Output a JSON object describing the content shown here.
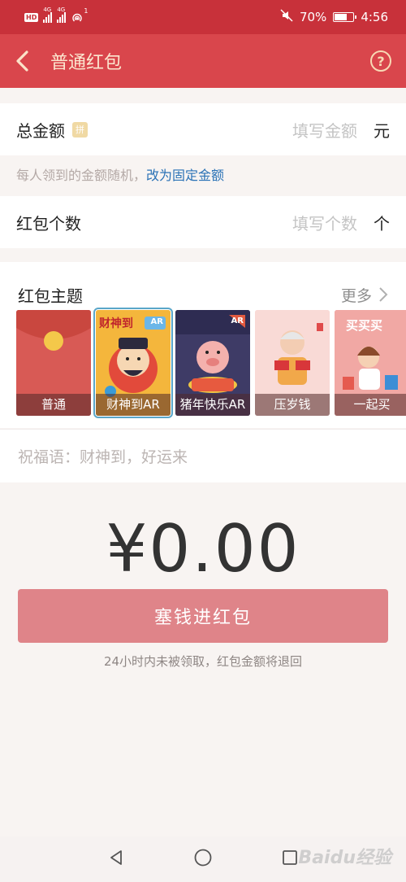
{
  "status_bar": {
    "hd": "HD",
    "net1": "4G",
    "net2": "4G",
    "hotspot_count": "1",
    "battery_percent": "70%",
    "battery_level": 0.7,
    "time": "4:56"
  },
  "header": {
    "title": "普通红包",
    "help_symbol": "?"
  },
  "total_amount": {
    "label": "总金额",
    "badge": "拼",
    "placeholder": "填写金额",
    "unit": "元"
  },
  "hint": {
    "text": "每人领到的金额随机，",
    "link": "改为固定金额"
  },
  "count": {
    "label": "红包个数",
    "placeholder": "填写个数",
    "unit": "个"
  },
  "theme": {
    "title": "红包主题",
    "more": "更多",
    "cards": [
      {
        "label": "普通",
        "selected": false
      },
      {
        "label": "财神到AR",
        "selected": true
      },
      {
        "label": "猪年快乐AR",
        "selected": false
      },
      {
        "label": "压岁钱",
        "selected": false
      },
      {
        "label": "一起买",
        "selected": false
      }
    ],
    "card_texts": {
      "caishen": "财神到",
      "ar": "AR",
      "maimai": "买买买"
    }
  },
  "blessing": {
    "placeholder": "祝福语：财神到，好运来"
  },
  "amount_display": "¥0.00",
  "submit_label": "塞钱进红包",
  "footer_note": "24小时内未被领取，红包金额将退回",
  "watermark": "Baidu经验",
  "colors": {
    "status_bar": "#c8313a",
    "title_bar": "#d9464c",
    "button": "#df8489",
    "link": "#2a72b6"
  }
}
